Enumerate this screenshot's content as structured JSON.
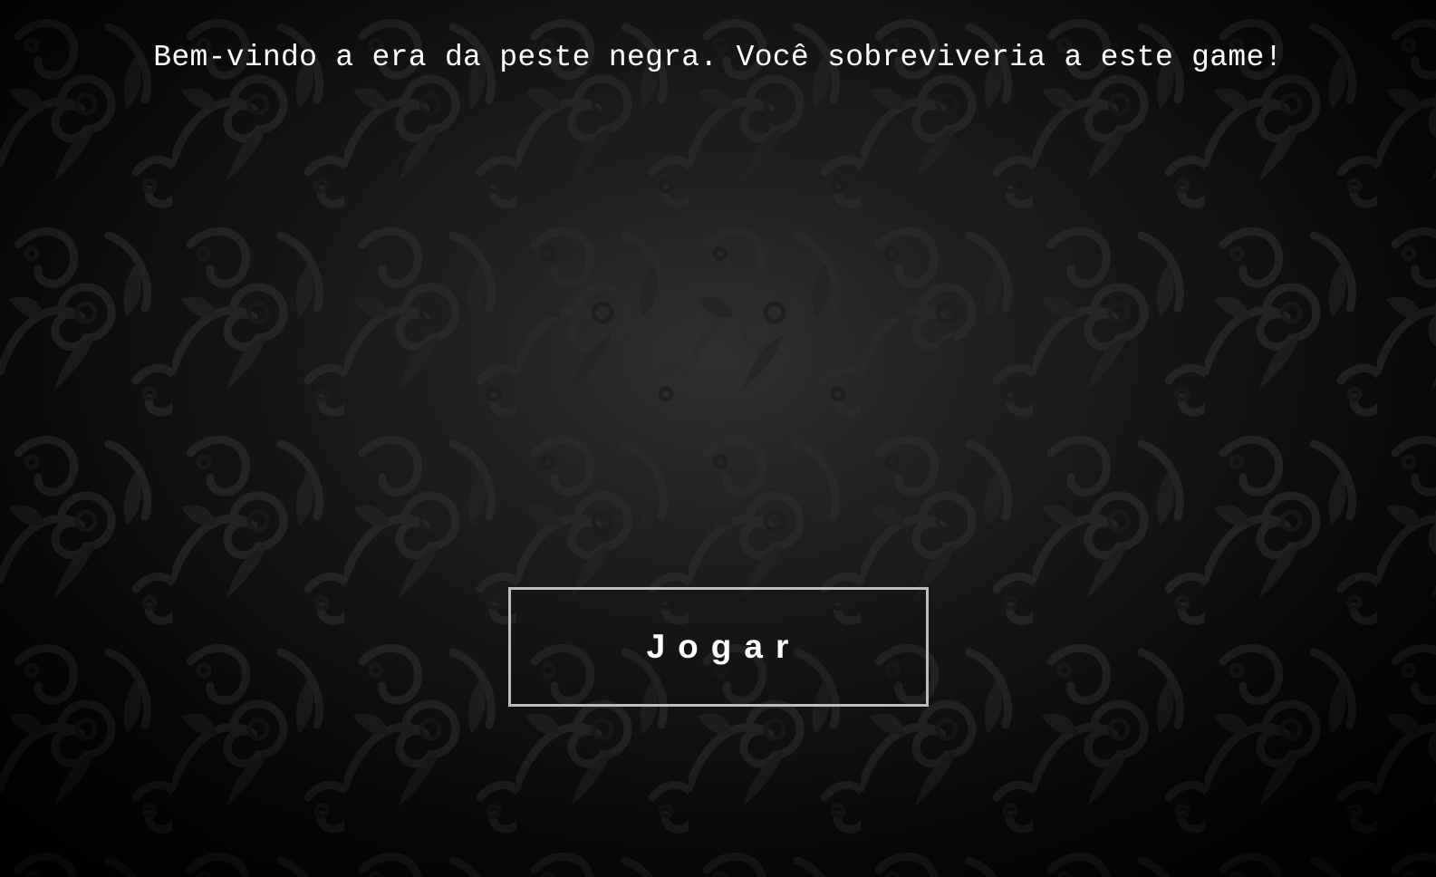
{
  "welcome_message": "Bem-vindo a era da peste negra. Você sobreviveria a este game!",
  "play_button_label": "Jogar",
  "colors": {
    "background": "#151515",
    "pattern": "#2a2a2a",
    "text": "#ffffff",
    "button_border": "#bdbdbd"
  }
}
